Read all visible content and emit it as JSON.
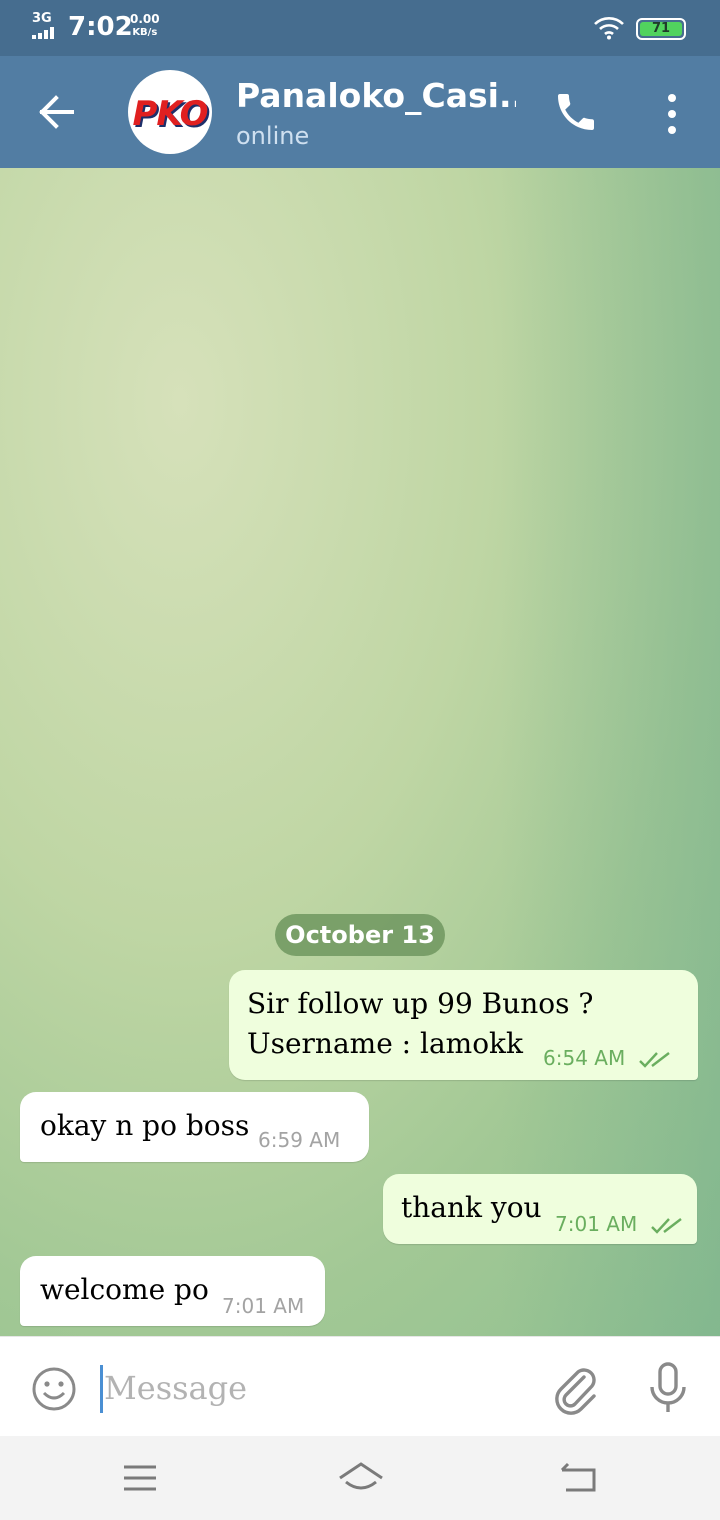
{
  "status_bar": {
    "network": "3G",
    "time": "7:02",
    "speed_value": "0.00",
    "speed_unit": "KB/s",
    "battery": "71",
    "icons": [
      "signal-icon",
      "wifi-icon",
      "battery-icon"
    ]
  },
  "header": {
    "avatar_text": "PKO",
    "title": "Panaloko_Casi...",
    "status": "online",
    "icons": [
      "back-arrow-icon",
      "phone-icon",
      "more-vertical-icon"
    ]
  },
  "chat": {
    "date_separator": "October 13",
    "messages": [
      {
        "direction": "out",
        "text": "Sir follow up 99 Bunos ?\nUsername : lamokk",
        "time": "6:54 AM",
        "read": true
      },
      {
        "direction": "in",
        "text": "okay n po boss",
        "time": "6:59 AM"
      },
      {
        "direction": "out",
        "text": "thank you",
        "time": "7:01 AM",
        "read": true
      },
      {
        "direction": "in",
        "text": "welcome po",
        "time": "7:01 AM"
      }
    ]
  },
  "composer": {
    "placeholder": "Message",
    "value": "",
    "icons": [
      "emoji-icon",
      "attach-icon",
      "mic-icon"
    ]
  },
  "nav_bar": {
    "icons": [
      "menu-icon",
      "home-icon",
      "back-icon"
    ]
  },
  "colors": {
    "header": "#527da3",
    "status_bar": "#466d8f",
    "outgoing_bubble": "#effedd",
    "incoming_bubble": "#ffffff",
    "read_check": "#6aae5f",
    "date_pill": "#6e965f"
  }
}
